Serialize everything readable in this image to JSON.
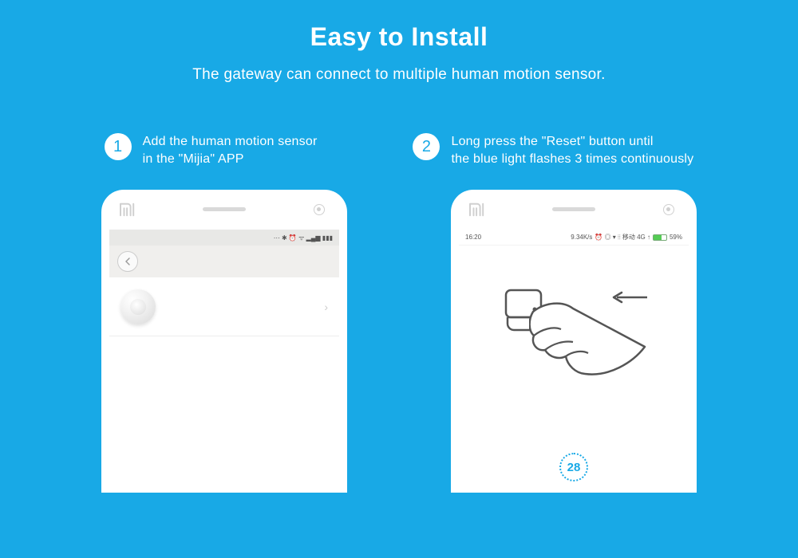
{
  "header": {
    "title": "Easy to Install",
    "subtitle": "The gateway can connect to multiple human motion sensor."
  },
  "steps": [
    {
      "num": "1",
      "line1": "Add the human motion sensor",
      "line2": "in the \"Mijia\" APP"
    },
    {
      "num": "2",
      "line1": "Long press the \"Reset\" button until",
      "line2": "the blue light flashes 3 times continuously"
    }
  ],
  "phone1": {
    "status_icons": "⋯ ✱ ⏰ ᯤ ▂▄▆ ▮▮▮"
  },
  "phone2": {
    "time": "16:20",
    "net_speed": "9.34K/s",
    "indicators": "⏰ ◎ ▾ ⦙⦙ 移动 4G ↑",
    "battery_pct": "59%",
    "countdown": "28"
  }
}
